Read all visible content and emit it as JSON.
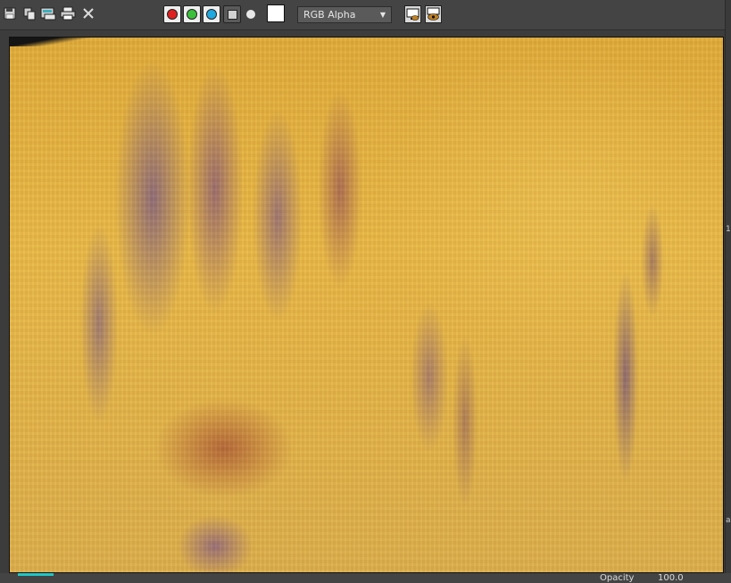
{
  "toolbar": {
    "icons": [
      "save-icon",
      "clone-icon",
      "copy-icon",
      "print-icon",
      "close-icon"
    ],
    "channels": {
      "red": "#e02020",
      "green": "#3cc03c",
      "blue": "#20a8e0"
    },
    "channel_select": {
      "selected": "RGB Alpha"
    }
  },
  "status": {
    "opacity_label": "Opacity",
    "opacity_value": "100.0"
  },
  "side": {
    "mark_1": "1",
    "mark_2": "a"
  }
}
